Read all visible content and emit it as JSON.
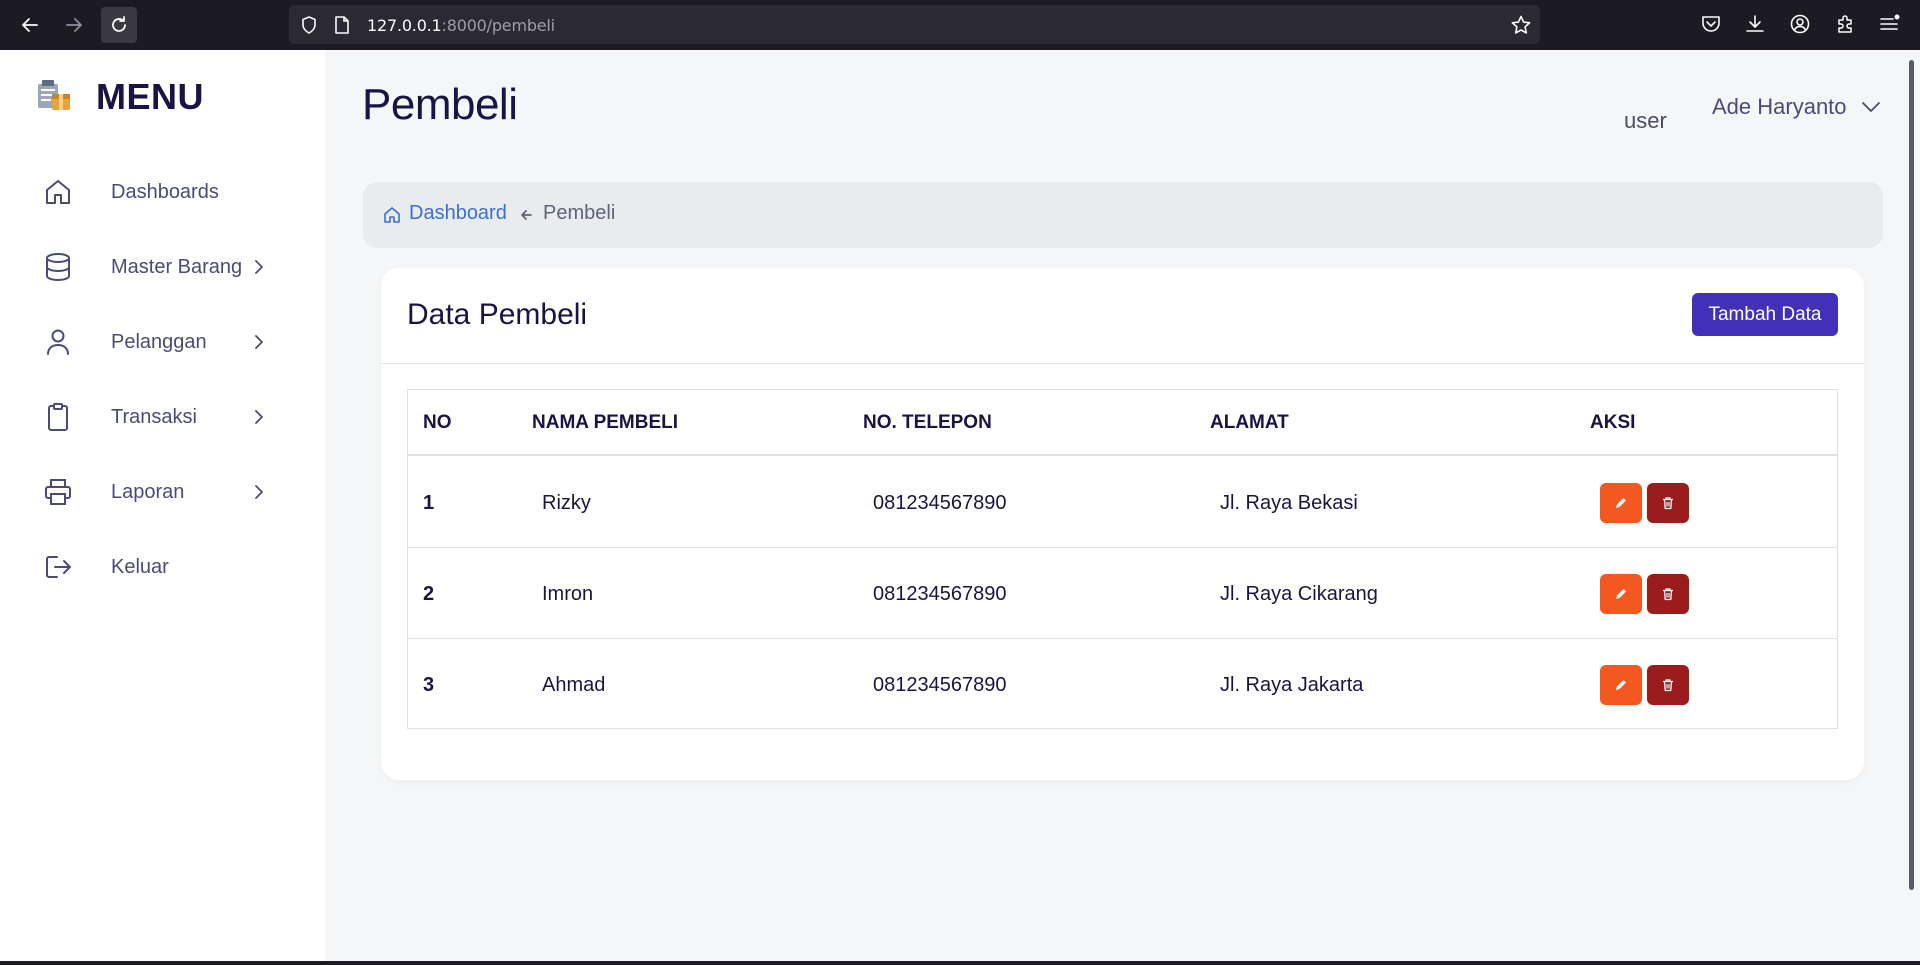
{
  "browser": {
    "url_host": "127.0.0.1",
    "url_rest": ":8000/pembeli"
  },
  "sidebar": {
    "title": "MENU",
    "items": [
      {
        "label": "Dashboards",
        "icon": "home-icon",
        "has_children": false
      },
      {
        "label": "Master Barang",
        "icon": "database-icon",
        "has_children": true
      },
      {
        "label": "Pelanggan",
        "icon": "user-icon",
        "has_children": true
      },
      {
        "label": "Transaksi",
        "icon": "clipboard-icon",
        "has_children": true
      },
      {
        "label": "Laporan",
        "icon": "printer-icon",
        "has_children": true
      },
      {
        "label": "Keluar",
        "icon": "logout-icon",
        "has_children": false
      }
    ]
  },
  "header": {
    "title": "Pembeli",
    "role": "user",
    "user_name": "Ade Haryanto"
  },
  "breadcrumb": {
    "home": "Dashboard",
    "current": "Pembeli"
  },
  "card": {
    "title": "Data Pembeli",
    "add_button": "Tambah Data"
  },
  "table": {
    "columns": [
      "NO",
      "NAMA PEMBELI",
      "NO. TELEPON",
      "ALAMAT",
      "AKSI"
    ],
    "rows": [
      {
        "no": "1",
        "nama": "Rizky",
        "telepon": "081234567890",
        "alamat": "Jl. Raya Bekasi"
      },
      {
        "no": "2",
        "nama": "Imron",
        "telepon": "081234567890",
        "alamat": "Jl. Raya Cikarang"
      },
      {
        "no": "3",
        "nama": "Ahmad",
        "telepon": "081234567890",
        "alamat": "Jl. Raya Jakarta"
      }
    ]
  },
  "colors": {
    "brand_dark": "#1a1446",
    "primary_button": "#4330b8",
    "edit_button": "#f2581f",
    "delete_button": "#9b1c1c",
    "link": "#3b6fd6"
  }
}
